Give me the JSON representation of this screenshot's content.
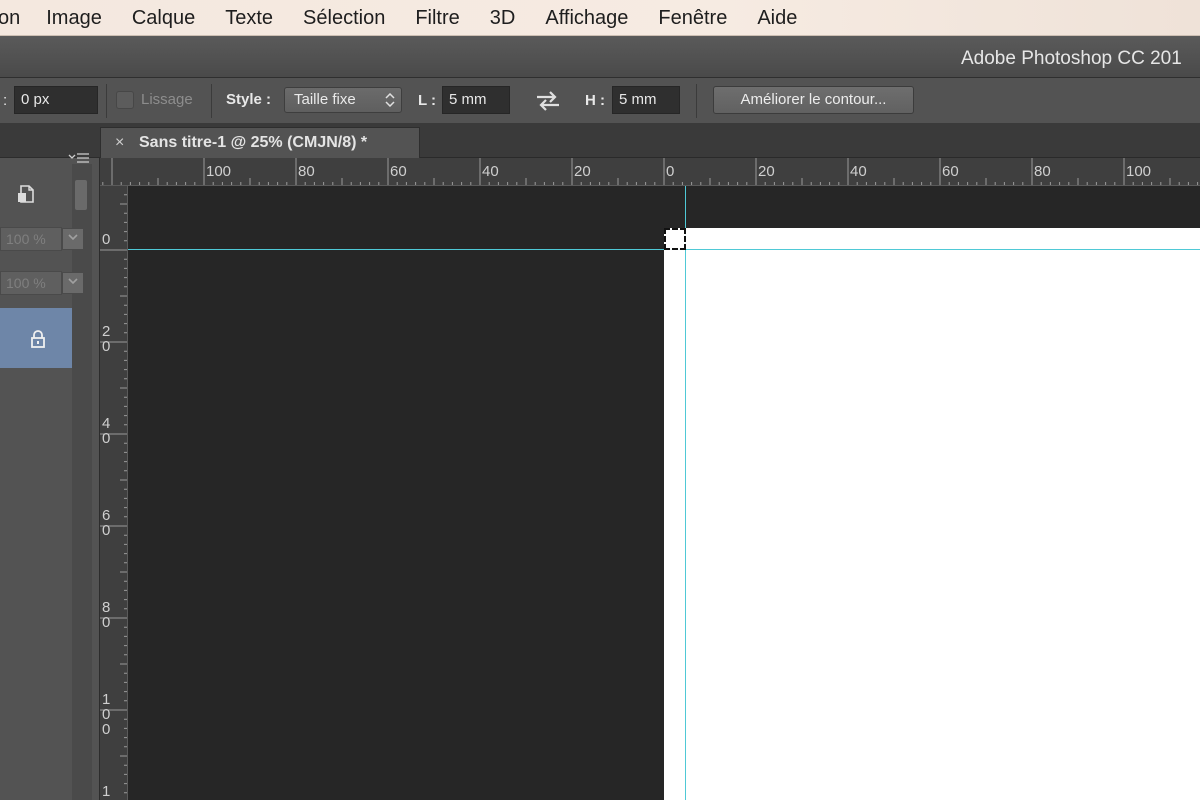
{
  "menubar": {
    "items": [
      "on",
      "Image",
      "Calque",
      "Texte",
      "Sélection",
      "Filtre",
      "3D",
      "Affichage",
      "Fenêtre",
      "Aide"
    ]
  },
  "titlebar": {
    "title": "Adobe Photoshop CC 201"
  },
  "options": {
    "feather_colon": ":",
    "feather_value": "0 px",
    "smoothing_label": "Lissage",
    "style_label": "Style :",
    "style_value": "Taille fixe",
    "width_label": "L :",
    "width_value": "5 mm",
    "height_label": "H :",
    "height_value": "5 mm",
    "refine_button": "Améliorer le contour..."
  },
  "panel": {
    "opacity_value": "100 %",
    "fill_value": "100 %"
  },
  "document": {
    "close_glyph": "×",
    "tab_title": "Sans titre-1 @ 25% (CMJN/8) *"
  },
  "rulers": {
    "horizontal": [
      "100",
      "80",
      "60",
      "40",
      "20",
      "0",
      "20",
      "40",
      "60",
      "80",
      "100"
    ],
    "vertical": [
      "0",
      "20",
      "40",
      "60",
      "80",
      "100",
      "1"
    ]
  },
  "colors": {
    "guide": "#4fc9d6",
    "selected_layer": "#6e86a8",
    "canvas_bg": "#262626"
  }
}
